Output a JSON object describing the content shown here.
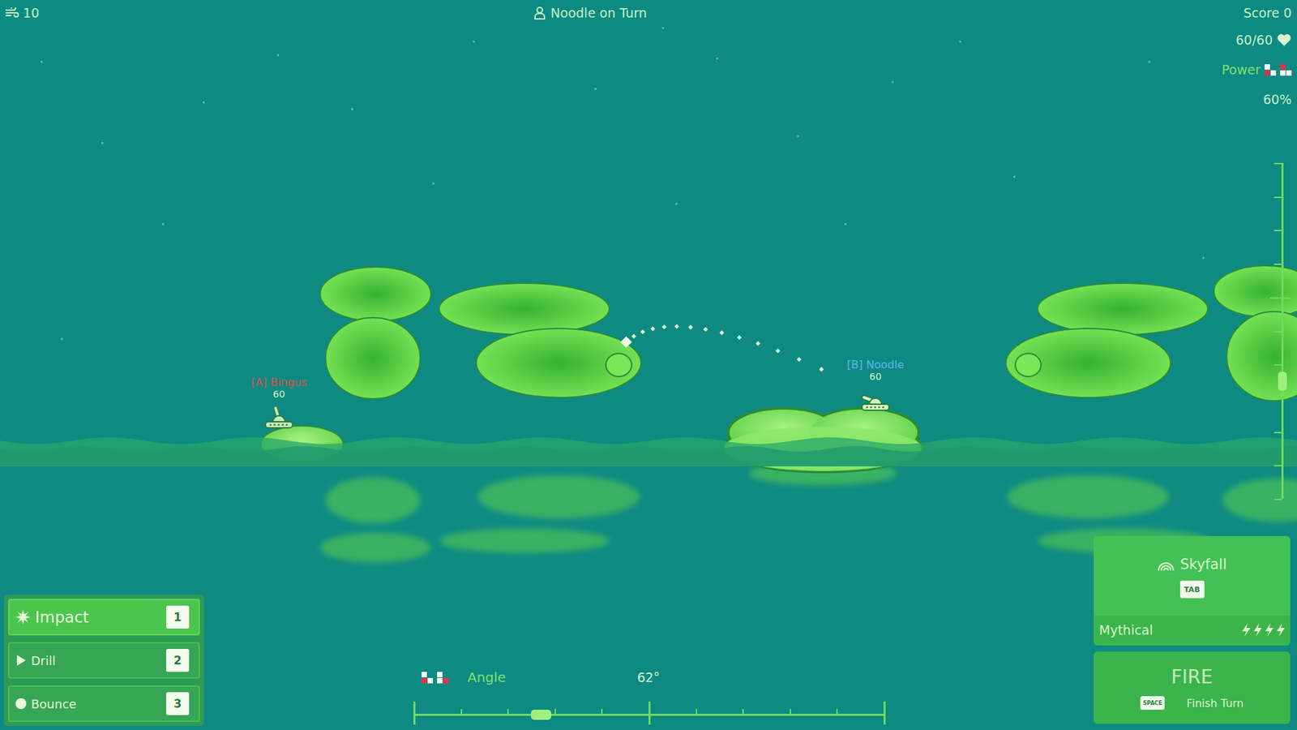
{
  "hud": {
    "wind": "10",
    "turn": "Noodle on Turn",
    "score": "Score 0",
    "health": "60/60",
    "power": {
      "label": "Power",
      "reading": "60%",
      "level": 0.35
    }
  },
  "players": [
    {
      "label": "[A] Bingus",
      "hp": "60",
      "color": "#d9544c",
      "on_turn": false
    },
    {
      "label": "[B] Noodle",
      "hp": "60",
      "color": "#5fb7e8",
      "on_turn": true
    }
  ],
  "weapons": [
    {
      "name": "Impact",
      "key": "1",
      "kind": "impact",
      "selected": true
    },
    {
      "name": "Drill",
      "key": "2",
      "kind": "drill",
      "selected": false
    },
    {
      "name": "Bounce",
      "key": "3",
      "kind": "bounce",
      "selected": false
    }
  ],
  "angle": {
    "label": "Angle",
    "reading": "62°",
    "level": 0.27
  },
  "special": {
    "name": "Skyfall",
    "key": "TAB",
    "rarity": "Mythical",
    "charges": 4
  },
  "fire": {
    "label": "FIRE",
    "key": "SPACE",
    "hint": "Finish Turn"
  }
}
